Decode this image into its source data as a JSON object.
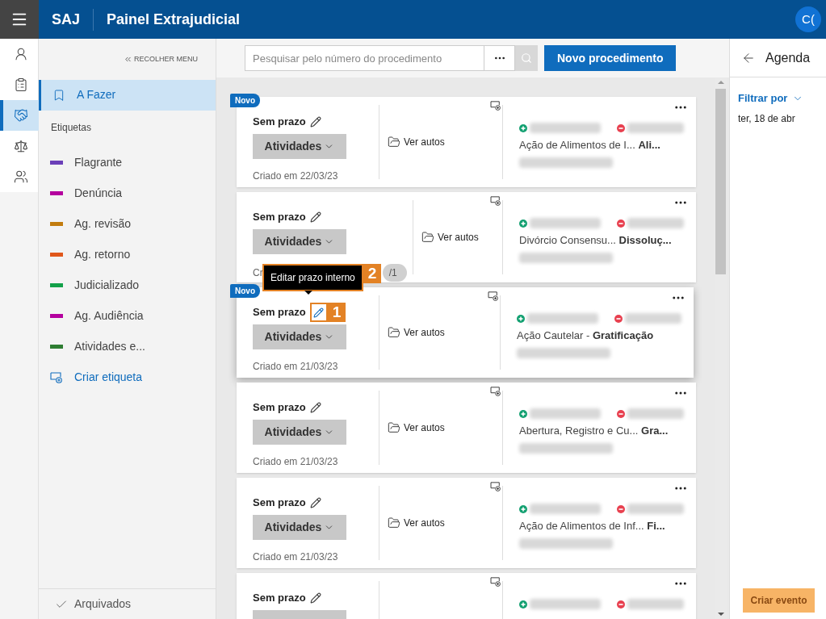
{
  "header": {
    "brand": "SAJ",
    "title": "Painel Extrajudicial",
    "avatar": "C("
  },
  "rail": {
    "items": [
      {
        "kind": "contact",
        "selected": false
      },
      {
        "kind": "clipboard",
        "selected": false
      },
      {
        "kind": "handshake",
        "selected": true
      },
      {
        "kind": "scale",
        "selected": false
      },
      {
        "kind": "group",
        "selected": false
      }
    ]
  },
  "sidebar": {
    "collapse": "RECOLHER MENU",
    "nav": [
      {
        "label": "A Fazer",
        "selected": true
      }
    ],
    "tags_heading": "Etiquetas",
    "tags": [
      {
        "label": "Flagrante",
        "color": "#6b3fb8"
      },
      {
        "label": "Denúncia",
        "color": "#b4009e"
      },
      {
        "label": "Ag. revisão",
        "color": "#c27c0e"
      },
      {
        "label": "Ag. retorno",
        "color": "#e0571b"
      },
      {
        "label": "Judicializado",
        "color": "#13a049"
      },
      {
        "label": "Ag. Audiência",
        "color": "#b4009e"
      },
      {
        "label": "Atividades e...",
        "color": "#2e7d32"
      }
    ],
    "create_tag": "Criar etiqueta",
    "archived": "Arquivados"
  },
  "toolbar": {
    "search": {
      "placeholder": "Pesquisar pelo número do procedimento"
    },
    "new_button": "Novo procedimento"
  },
  "cards": [
    {
      "badge": "Novo",
      "deadline": "Sem prazo",
      "activities": "Atividades",
      "created": "Criado em 22/03/23",
      "link": "Ver autos",
      "class": "Ação de Alimentos de I...",
      "subject": "Ali...",
      "elevated": false
    },
    {
      "deadline": "Sem prazo",
      "activities": "Atividades",
      "created": "Cr",
      "counter": "/1",
      "link": "Ver autos",
      "class": "Divórcio Consensu...",
      "subject": "Dissoluç...",
      "elevated": false
    },
    {
      "badge": "Novo",
      "deadline": "Sem prazo",
      "activities": "Atividades",
      "created": "Criado em 21/03/23",
      "link": "Ver autos",
      "class": "Ação Cautelar -",
      "subject": "Gratificação",
      "elevated": true,
      "pencil_callout": "1",
      "tooltip": {
        "text": "Editar prazo interno",
        "callout": "2"
      }
    },
    {
      "deadline": "Sem prazo",
      "activities": "Atividades",
      "created": "Criado em 21/03/23",
      "link": "Ver autos",
      "class": "Abertura, Registro e Cu...",
      "subject": "Gra...",
      "elevated": false
    },
    {
      "deadline": "Sem prazo",
      "activities": "Atividades",
      "created": "Criado em 21/03/23",
      "link": "Ver autos",
      "class": "Ação de Alimentos de Inf...",
      "subject": "Fi...",
      "elevated": false
    },
    {
      "deadline": "Sem prazo",
      "elevated": false
    }
  ],
  "agenda": {
    "title": "Agenda",
    "filter": "Filtrar por",
    "date": "ter, 18 de abr",
    "create": "Criar evento"
  }
}
